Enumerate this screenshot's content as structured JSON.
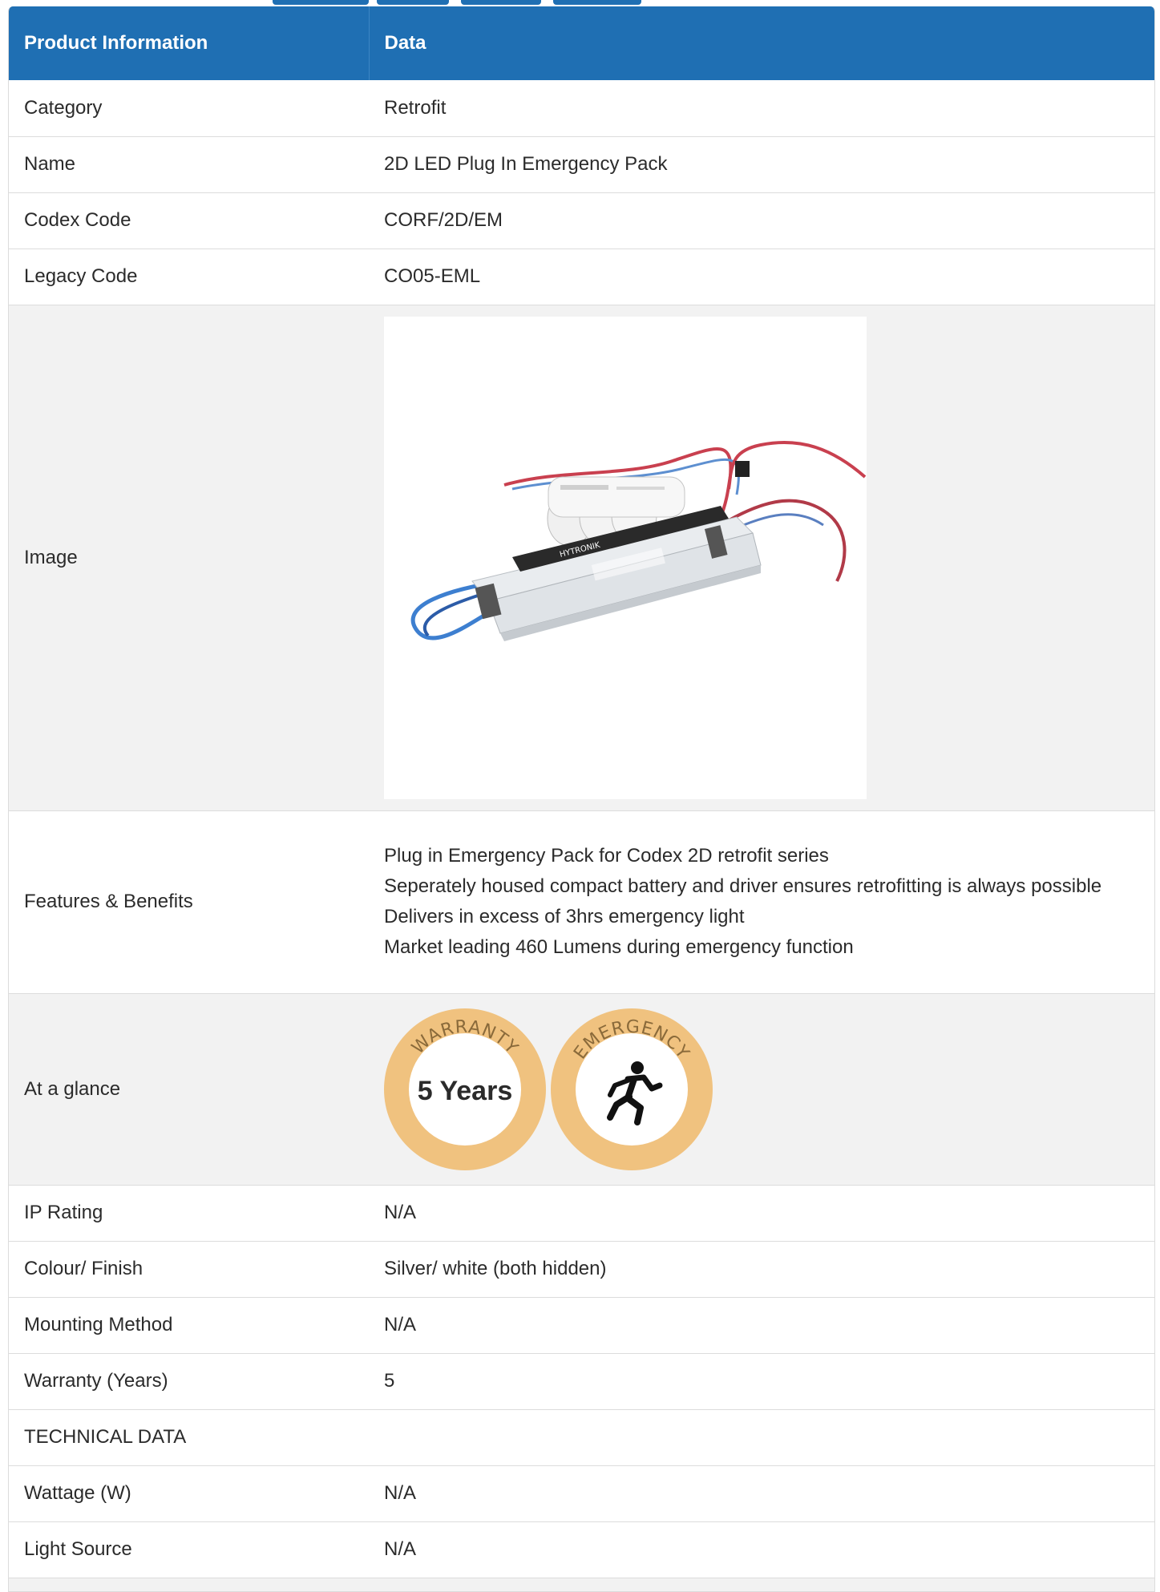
{
  "table": {
    "headers": [
      "Product Information",
      "Data"
    ],
    "rows": {
      "category": {
        "label": "Category",
        "value": "Retrofit"
      },
      "name": {
        "label": "Name",
        "value": "2D LED Plug In Emergency Pack"
      },
      "codex_code": {
        "label": "Codex Code",
        "value": "CORF/2D/EM"
      },
      "legacy_code": {
        "label": "Legacy Code",
        "value": "CO05-EML"
      },
      "image": {
        "label": "Image",
        "product_brand": "HYTRONIK"
      },
      "features": {
        "label": "Features & Benefits",
        "lines": [
          "Plug in Emergency Pack for Codex 2D retrofit series",
          "Seperately housed compact battery and driver ensures retrofitting is always possible",
          "Delivers in excess of 3hrs emergency light",
          "Market leading 460 Lumens during emergency function"
        ]
      },
      "glance": {
        "label": "At a glance",
        "warranty_badge": {
          "title": "WARRANTY",
          "text": "5 Years"
        },
        "emergency_badge": {
          "title": "EMERGENCY",
          "icon": "running-man-icon"
        }
      },
      "ip_rating": {
        "label": "IP Rating",
        "value": "N/A"
      },
      "colour_finish": {
        "label": "Colour/ Finish",
        "value": "Silver/ white (both hidden)"
      },
      "mounting_method": {
        "label": "Mounting Method",
        "value": "N/A"
      },
      "warranty_years": {
        "label": "Warranty (Years)",
        "value": "5"
      },
      "technical_data": {
        "label": "TECHNICAL DATA",
        "value": ""
      },
      "wattage": {
        "label": "Wattage (W)",
        "value": "N/A"
      },
      "light_source": {
        "label": "Light Source",
        "value": "N/A"
      }
    }
  },
  "colors": {
    "header_bg": "#1f6fb3",
    "badge_ring": "#f0c27f",
    "logo_blue": "#1f6fb3"
  }
}
